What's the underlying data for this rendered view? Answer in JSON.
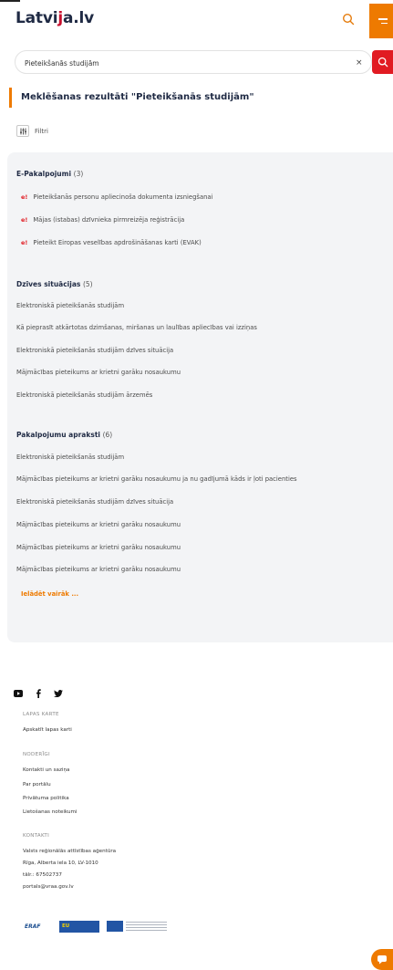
{
  "header": {
    "logo_text": "Latvija.lv",
    "logo_prefix": "Latvi",
    "logo_mark": "j",
    "logo_suffix": "a.lv",
    "search_icon": "search-icon",
    "menu_icon": "hamburger-icon"
  },
  "search": {
    "value": "Pieteikšanās studijām",
    "clear_label": "×",
    "button_icon": "search-icon"
  },
  "results": {
    "title": "Meklēšanas rezultāti \"Pieteikšanās studijām\"",
    "filter_label": "Filtri"
  },
  "categories": {
    "e_services": {
      "title": "E-Pakalpojumi",
      "count": "(3)",
      "badge": "e!",
      "items": [
        "Pieteikšanās personu apliecinoša dokumenta izsniegšanai",
        "Mājas (istabas) dzīvnieka pirmreizēja reģistrācija",
        "Pieteikt Eiropas veselības apdrošināšanas karti (EVAK)"
      ]
    },
    "life_situations": {
      "title": "Dzīves situācijas",
      "count": "(5)",
      "items": [
        "Elektroniskā pieteikšanās studijām",
        "Kā pieprasīt atkārtotas dzimšanas, miršanas un laulības apliecības vai izziņas",
        "Elektroniskā pieteikšanās studijām dzīves situācija",
        "Mājmācības pieteikums ar krietni garāku nosaukumu",
        "Elektroniskā pieteikšanās studijām ārzemēs"
      ]
    },
    "service_descriptions": {
      "title": "Pakalpojumu apraksti",
      "count": "(6)",
      "items": [
        "Elektroniskā pieteikšanās studijām",
        "Mājmācības pieteikums ar krietni garāku nosaukumu ja nu gadījumā kāds ir ļoti pacienties",
        "Elektroniskā pieteikšanās studijām dzīves situācija",
        "Mājmācības pieteikums ar krietni garāku nosaukumu",
        "Mājmācības pieteikums ar krietni garāku nosaukumu",
        "Mājmācības pieteikums ar krietni garāku nosaukumu"
      ]
    },
    "load_more": "Ielādēt vairāk ..."
  },
  "footer": {
    "social": [
      "youtube-icon",
      "facebook-icon",
      "twitter-icon"
    ],
    "sitemap_heading": "LAPAS KARTE",
    "sitemap_link": "Apskatīt lapas karti",
    "useful_heading": "NODERĪGI",
    "useful_links": [
      "Kontakti un saziņa",
      "Par portālu",
      "Privātuma politika",
      "Lietošanas noteikumi"
    ],
    "contacts_heading": "KONTAKTI",
    "contacts": [
      "Valsts reģionālās attīstības aģentūra",
      "Rīga, Alberta iela 10, LV-1010",
      "tālr.: 67502737",
      "portals@vraa.gov.lv"
    ],
    "logo_eraf": "ERAF",
    "logo_eu": "EU"
  },
  "chat": {
    "icon": "chat-icon"
  },
  "colors": {
    "accent": "#ee7a00",
    "brand_red": "#e11b22",
    "navy": "#1f2a44"
  }
}
